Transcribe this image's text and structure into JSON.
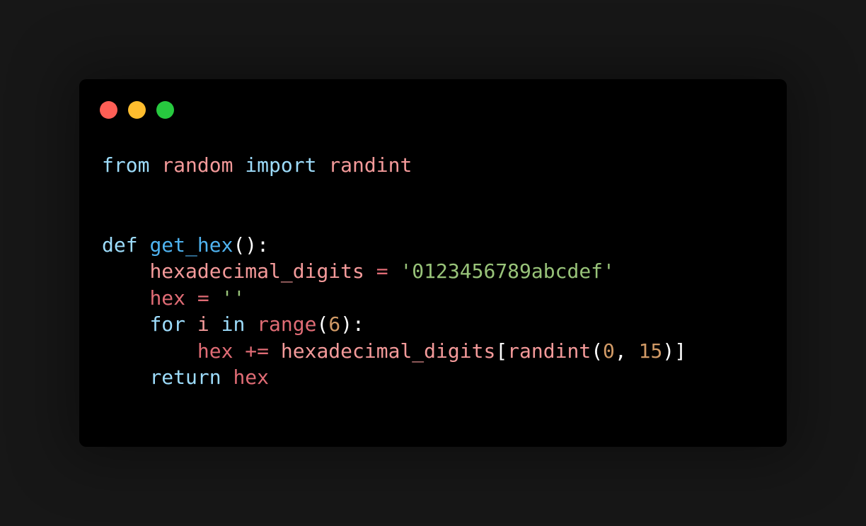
{
  "colors": {
    "background": "#171717",
    "window": "#000000",
    "close": "#ff5f56",
    "minimize": "#ffbd2e",
    "maximize": "#27c93f",
    "keyword": "#9ddcfb",
    "identifier": "#f49a9a",
    "variable": "#e06c75",
    "function": "#4fb3f0",
    "string": "#98c379",
    "number": "#d19a66",
    "punct": "#ffffff"
  },
  "window_controls": [
    "close-dot",
    "minimize-dot",
    "maximize-dot"
  ],
  "code_lines": [
    [
      {
        "t": "from",
        "c": "keyword"
      },
      {
        "t": " ",
        "c": "punct"
      },
      {
        "t": "random",
        "c": "identifier"
      },
      {
        "t": " ",
        "c": "punct"
      },
      {
        "t": "import",
        "c": "keyword"
      },
      {
        "t": " ",
        "c": "punct"
      },
      {
        "t": "randint",
        "c": "identifier"
      }
    ],
    [],
    [],
    [
      {
        "t": "def",
        "c": "keyword"
      },
      {
        "t": " ",
        "c": "punct"
      },
      {
        "t": "get_hex",
        "c": "function"
      },
      {
        "t": "():",
        "c": "punct"
      }
    ],
    [
      {
        "t": "    ",
        "c": "punct"
      },
      {
        "t": "hexadecimal_digits",
        "c": "identifier"
      },
      {
        "t": " ",
        "c": "punct"
      },
      {
        "t": "=",
        "c": "variable"
      },
      {
        "t": " ",
        "c": "punct"
      },
      {
        "t": "'0123456789abcdef'",
        "c": "string"
      }
    ],
    [
      {
        "t": "    ",
        "c": "punct"
      },
      {
        "t": "hex",
        "c": "variable"
      },
      {
        "t": " ",
        "c": "punct"
      },
      {
        "t": "=",
        "c": "variable"
      },
      {
        "t": " ",
        "c": "punct"
      },
      {
        "t": "''",
        "c": "string"
      }
    ],
    [
      {
        "t": "    ",
        "c": "punct"
      },
      {
        "t": "for",
        "c": "keyword"
      },
      {
        "t": " ",
        "c": "punct"
      },
      {
        "t": "i",
        "c": "identifier"
      },
      {
        "t": " ",
        "c": "punct"
      },
      {
        "t": "in",
        "c": "keyword"
      },
      {
        "t": " ",
        "c": "punct"
      },
      {
        "t": "range",
        "c": "variable"
      },
      {
        "t": "(",
        "c": "punct"
      },
      {
        "t": "6",
        "c": "number"
      },
      {
        "t": "):",
        "c": "punct"
      }
    ],
    [
      {
        "t": "        ",
        "c": "punct"
      },
      {
        "t": "hex",
        "c": "variable"
      },
      {
        "t": " ",
        "c": "punct"
      },
      {
        "t": "+=",
        "c": "variable"
      },
      {
        "t": " ",
        "c": "punct"
      },
      {
        "t": "hexadecimal_digits",
        "c": "identifier"
      },
      {
        "t": "[",
        "c": "punct"
      },
      {
        "t": "randint",
        "c": "identifier"
      },
      {
        "t": "(",
        "c": "punct"
      },
      {
        "t": "0",
        "c": "number"
      },
      {
        "t": ", ",
        "c": "punct"
      },
      {
        "t": "15",
        "c": "number"
      },
      {
        "t": ")]",
        "c": "punct"
      }
    ],
    [
      {
        "t": "    ",
        "c": "punct"
      },
      {
        "t": "return",
        "c": "keyword"
      },
      {
        "t": " ",
        "c": "punct"
      },
      {
        "t": "hex",
        "c": "variable"
      }
    ]
  ]
}
